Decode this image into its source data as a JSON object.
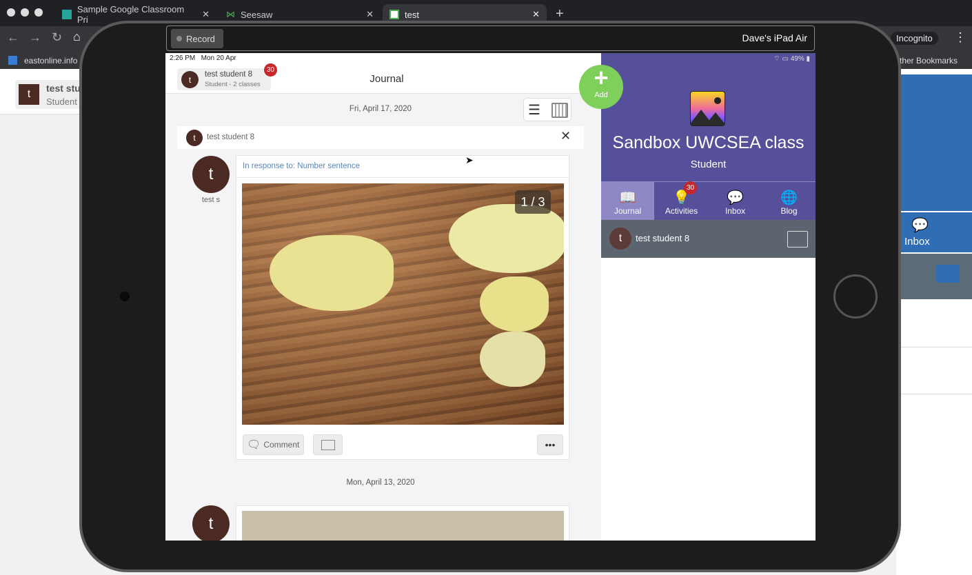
{
  "browser": {
    "tabs": [
      {
        "label": "Sample Google Classroom Pri",
        "active": false
      },
      {
        "label": "Seesaw",
        "active": false
      },
      {
        "label": "test",
        "active": true
      }
    ],
    "new_tab": "+",
    "close": "✕",
    "incognito": "Incognito",
    "bookmark": "eastonline.info",
    "other_bookmarks": "ther Bookmarks",
    "bg_page": {
      "user_name": "test stu",
      "user_role": "Student",
      "inbox": "Inbox"
    }
  },
  "recorder": {
    "record_label": "Record",
    "device_name": "Dave's iPad Air"
  },
  "status": {
    "time": "2:26 PM",
    "date": "Mon 20 Apr",
    "battery": "49%"
  },
  "header": {
    "user_name": "test student 8",
    "user_sub": "Student - 2 classes",
    "badge": "30",
    "title": "Journal",
    "add_label": "Add"
  },
  "journal": {
    "date1": "Fri, April 17, 2020",
    "post_author": "test student 8",
    "author_initial": "t",
    "author_short": "test s",
    "response": "In response to: Number sentence",
    "page_counter": "1 / 3",
    "comment_label": "Comment",
    "more": "•••",
    "date2": "Mon, April 13, 2020"
  },
  "class_panel": {
    "name": "Sandbox UWCSEA class",
    "role": "Student",
    "nav": [
      {
        "label": "Journal",
        "active": true
      },
      {
        "label": "Activities",
        "badge": "30"
      },
      {
        "label": "Inbox"
      },
      {
        "label": "Blog"
      }
    ],
    "student": "test student 8",
    "accent": "#56509a"
  }
}
